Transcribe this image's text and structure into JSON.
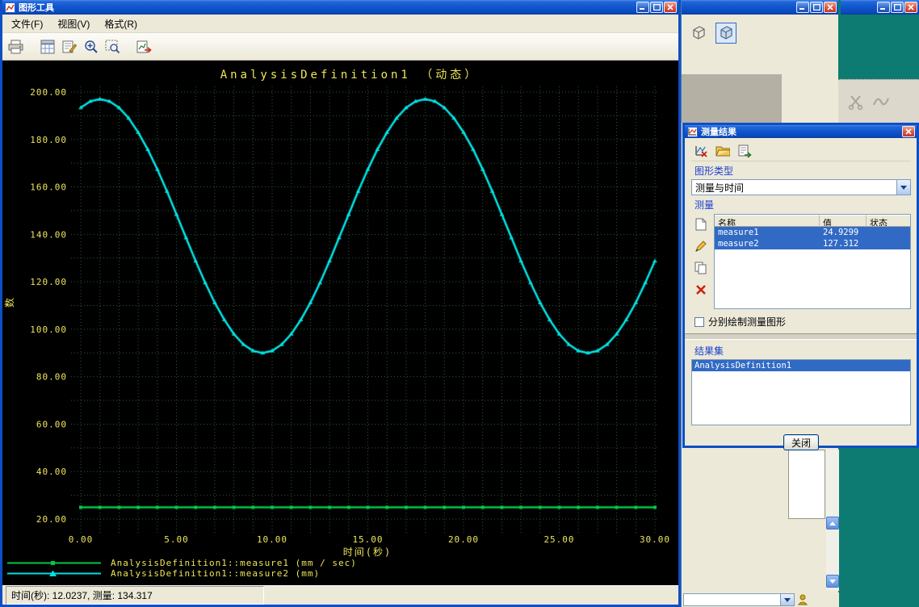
{
  "window": {
    "title": "图形工具",
    "menus": [
      "文件(F)",
      "视图(V)",
      "格式(R)"
    ],
    "toolbar": [
      "print",
      "grid-settings",
      "edit-sheet",
      "zoom-in",
      "zoom-window",
      "export-graph"
    ],
    "status_text": "时间(秒): 12.0237, 测量: 134.317"
  },
  "chart_data": {
    "type": "line",
    "title": "AnalysisDefinition1 （动态）",
    "xlabel": "时间(秒)",
    "ylabel": "数",
    "xlim": [
      0,
      30
    ],
    "ylim": [
      20,
      200
    ],
    "x_ticks": [
      0,
      5,
      10,
      15,
      20,
      25,
      30
    ],
    "x_tick_labels": [
      "0.00",
      "5.00",
      "10.00",
      "15.00",
      "20.00",
      "25.00",
      "30.00"
    ],
    "y_ticks": [
      20,
      40,
      60,
      80,
      100,
      120,
      140,
      160,
      180,
      200
    ],
    "y_tick_labels": [
      "20.00",
      "40.00",
      "60.00",
      "80.00",
      "100.00",
      "120.00",
      "140.00",
      "160.00",
      "180.00",
      "200.00"
    ],
    "grid": {
      "x_step": 1,
      "y_step": 10,
      "style": "dotted",
      "color": "#2a5a36"
    },
    "text_color": "#efe65a",
    "background": "#000000",
    "legend_position": "bottom-left",
    "series": [
      {
        "name": "AnalysisDefinition1::measure1 (mm / sec)",
        "color": "#00c846",
        "marker": "square",
        "type": "constant",
        "value": 24.93,
        "x_range": [
          0,
          30
        ],
        "x_step": 1
      },
      {
        "name": "AnalysisDefinition1::measure2 (mm)",
        "color": "#00e0e0",
        "marker": "triangle",
        "x_start": 0,
        "x_step": 0.5,
        "values": [
          193.4,
          196.1,
          197.0,
          196.1,
          193.4,
          189.0,
          183.0,
          175.8,
          167.4,
          158.2,
          148.4,
          138.6,
          128.8,
          119.6,
          111.2,
          104.0,
          98.0,
          93.6,
          90.9,
          90.0,
          90.9,
          93.6,
          98.0,
          104.0,
          111.2,
          119.6,
          128.8,
          138.6,
          148.4,
          158.2,
          167.4,
          175.8,
          183.0,
          189.0,
          193.4,
          196.1,
          197.0,
          196.1,
          193.4,
          189.0,
          183.0,
          175.8,
          167.4,
          158.2,
          148.4,
          138.6,
          128.8,
          119.6,
          111.2,
          104.0,
          98.0,
          93.6,
          90.9,
          90.0,
          90.9,
          93.6,
          98.0,
          104.0,
          111.2,
          119.6,
          128.8
        ]
      }
    ]
  },
  "dialog": {
    "title": "测量结果",
    "graph_type_label": "图形类型",
    "graph_type_value": "测量与时间",
    "measures_label": "测量",
    "table": {
      "headers": [
        "名称",
        "值",
        "状态"
      ],
      "rows": [
        {
          "name": "measure1",
          "value": "24.9299",
          "status": ""
        },
        {
          "name": "measure2",
          "value": "127.312",
          "status": ""
        }
      ]
    },
    "separate_graphs_label": "分别绘制测量图形",
    "result_set_label": "结果集",
    "result_items": [
      "AnalysisDefinition1"
    ],
    "close_label": "关闭"
  }
}
